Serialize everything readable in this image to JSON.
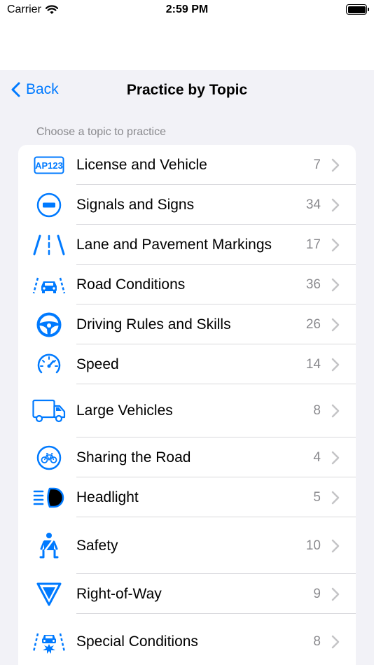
{
  "status": {
    "carrier": "Carrier",
    "time": "2:59 PM",
    "wifi_icon": "wifi-icon",
    "battery_level": 1.0
  },
  "nav": {
    "back_label": "Back",
    "title": "Practice by Topic"
  },
  "section": {
    "header": "Choose a topic to practice"
  },
  "accent_color": "#007aff",
  "topics": [
    {
      "label": "License and Vehicle",
      "count": "7",
      "icon": "license-plate-icon"
    },
    {
      "label": "Signals and Signs",
      "count": "34",
      "icon": "no-entry-sign-icon"
    },
    {
      "label": "Lane and Pavement Markings",
      "count": "17",
      "icon": "lane-markings-icon"
    },
    {
      "label": "Road Conditions",
      "count": "36",
      "icon": "car-road-icon"
    },
    {
      "label": "Driving Rules and Skills",
      "count": "26",
      "icon": "steering-wheel-icon"
    },
    {
      "label": "Speed",
      "count": "14",
      "icon": "speedometer-icon"
    },
    {
      "label": "Large Vehicles",
      "count": "8",
      "icon": "truck-icon"
    },
    {
      "label": "Sharing the Road",
      "count": "4",
      "icon": "bicycle-icon"
    },
    {
      "label": "Headlight",
      "count": "5",
      "icon": "headlight-icon"
    },
    {
      "label": "Safety",
      "count": "10",
      "icon": "seatbelt-icon"
    },
    {
      "label": "Right-of-Way",
      "count": "9",
      "icon": "yield-sign-icon"
    },
    {
      "label": "Special Conditions",
      "count": "8",
      "icon": "car-crash-icon"
    }
  ]
}
